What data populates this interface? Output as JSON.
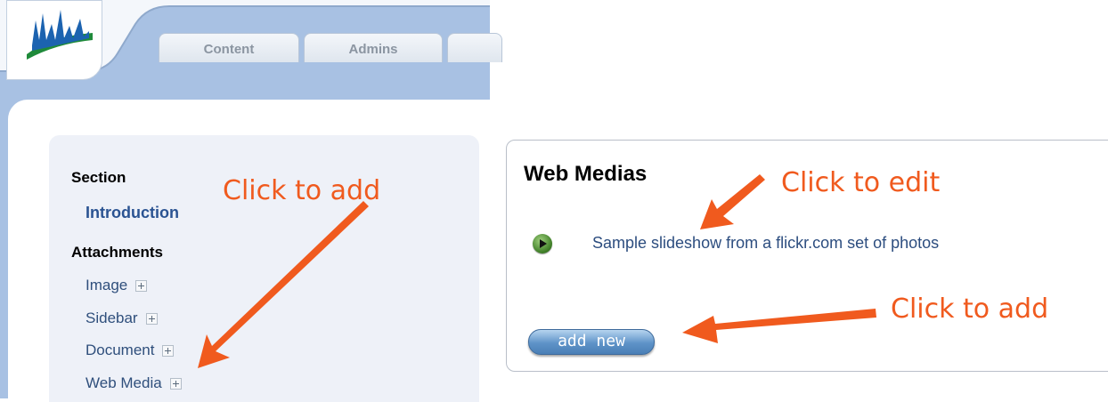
{
  "header": {
    "tabs": [
      {
        "label": "Content"
      },
      {
        "label": "Admins"
      },
      {
        "label": ""
      }
    ]
  },
  "nav": {
    "section_heading": "Section",
    "section_link": "Introduction",
    "attachments_heading": "Attachments",
    "items": [
      {
        "label": "Image"
      },
      {
        "label": "Sidebar"
      },
      {
        "label": "Document"
      },
      {
        "label": "Web Media"
      }
    ]
  },
  "media_panel": {
    "title": "Web Medias",
    "items": [
      {
        "label": "Sample slideshow from a flickr.com set of photos"
      }
    ],
    "add_button_label": "add new"
  },
  "annotations": {
    "nav_add": "Click to add",
    "edit": "Click to edit",
    "panel_add": "Click to add"
  },
  "colors": {
    "header_blue": "#a8c1e3",
    "annotation_orange": "#f05a1e",
    "nav_panel_bg": "#eef1f8",
    "link_blue": "#2a5392"
  }
}
